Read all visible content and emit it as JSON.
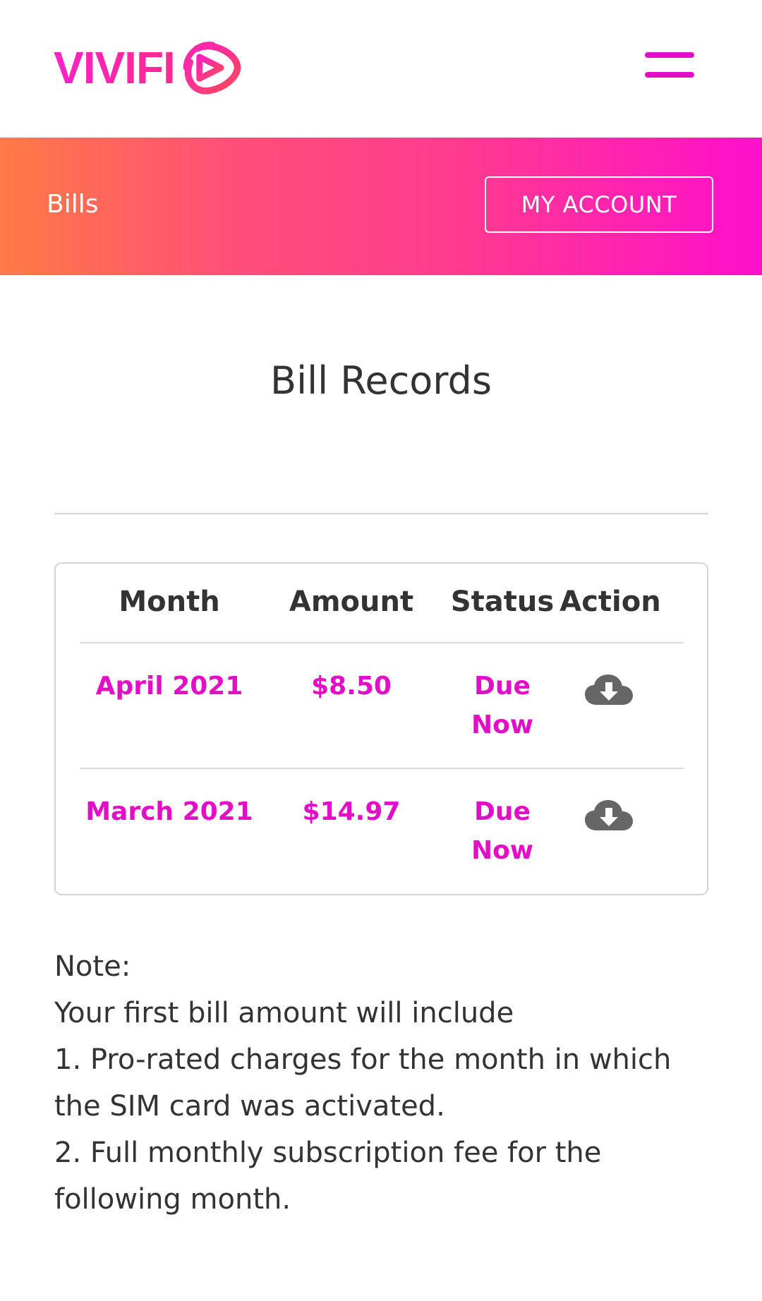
{
  "header": {
    "logo_text": "VIVIFI",
    "brand_colors": [
      "#ff22c8",
      "#ff2a8e",
      "#e10fc8"
    ],
    "menu_icon": "hamburger-icon"
  },
  "banner": {
    "title": "Bills",
    "account_button_label": "MY ACCOUNT",
    "gradient": [
      "#ff7a45",
      "#ff0fcc"
    ]
  },
  "main": {
    "title": "Bill Records",
    "table": {
      "headers": [
        "Month",
        "Amount",
        "Status",
        "Action"
      ],
      "rows": [
        {
          "month": "April 2021",
          "amount": "$8.50",
          "status_line1": "Due",
          "status_line2": "Now",
          "action_icon": "cloud-download-icon"
        },
        {
          "month": "March 2021",
          "amount": "$14.97",
          "status_line1": "Due",
          "status_line2": "Now",
          "action_icon": "cloud-download-icon"
        }
      ]
    },
    "note": {
      "lines": [
        "Note:",
        "Your first bill amount will include",
        "1. Pro-rated charges for the month in which",
        "the SIM card was activated.",
        "2. Full monthly subscription fee for the",
        "following month."
      ]
    },
    "accent_color": "#e20fc6"
  }
}
